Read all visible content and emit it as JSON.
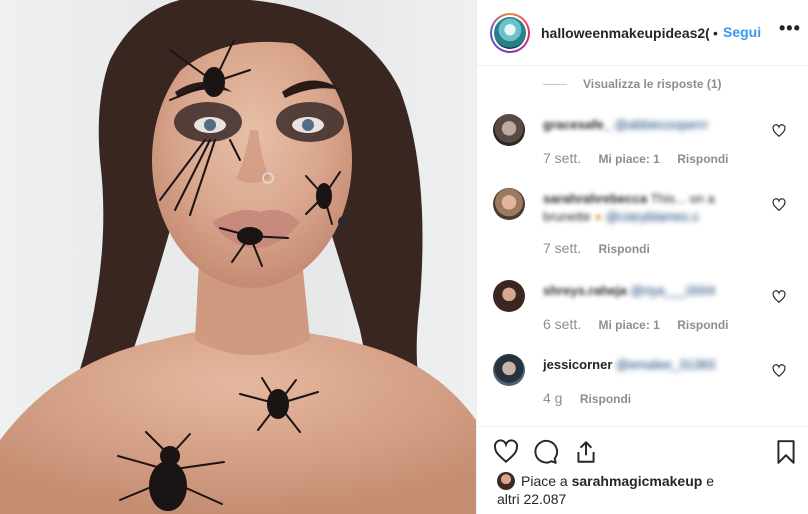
{
  "post": {
    "username": "halloweenmakeupideas2(",
    "follow_label": "Segui",
    "more_label": "•••",
    "dot": "•"
  },
  "comments": {
    "view_replies": "Visualizza le risposte (1)",
    "items": [
      {
        "user": "gracesafe_",
        "mention": "@abbiecooperrr",
        "body": "",
        "time": "7 sett.",
        "likes": "Mi piace: 1",
        "reply": "Rispondi"
      },
      {
        "user": "sarahrahrebecca",
        "body": "This... on a",
        "body2": "brunette",
        "mention": "@ciaryblames.x",
        "time": "7 sett.",
        "likes": "",
        "reply": "Rispondi"
      },
      {
        "user": "shreys.raheja",
        "mention": "@riya___0004",
        "body": "",
        "time": "6 sett.",
        "likes": "Mi piace: 1",
        "reply": "Rispondi"
      },
      {
        "user": "jessicorner",
        "mention": "@emalee_31383",
        "body": "",
        "time": "4 g",
        "likes": "",
        "reply": "Rispondi"
      }
    ]
  },
  "likes": {
    "prefix": "Piace a",
    "user": "sarahmagicmakeup",
    "suffix": "e",
    "others": "altri 22.087"
  },
  "icons": {
    "like": "heart-icon",
    "comment": "comment-icon",
    "share": "share-icon",
    "save": "bookmark-icon",
    "comment_like": "heart-icon"
  }
}
